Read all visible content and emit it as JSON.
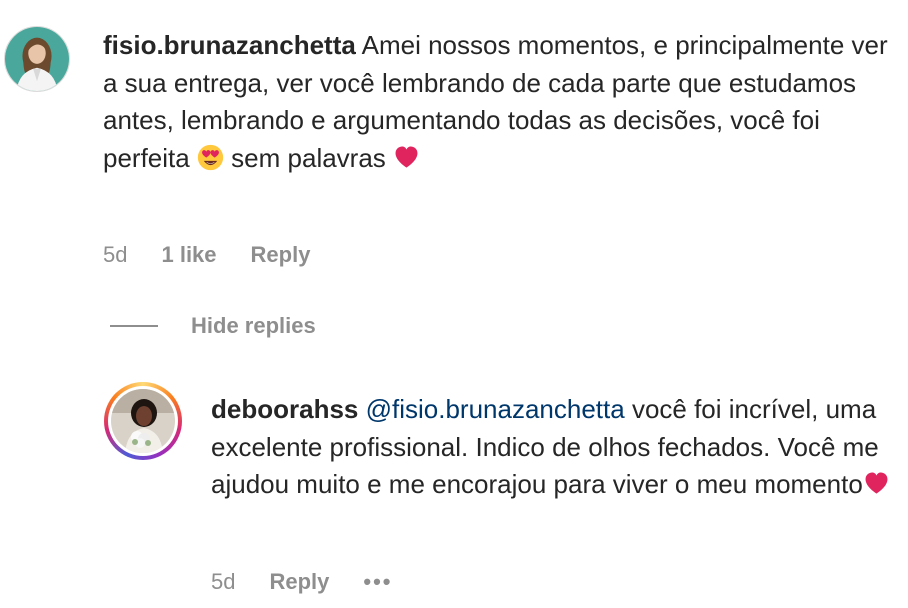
{
  "comment1": {
    "username": "fisio.brunazanchetta",
    "text_part1": " Amei nossos momentos, e principalmente ver a sua entrega, ver você lembrando de cada parte que estudamos antes, lembrando e argumentando todas as decisões, você foi perfeita ",
    "emoji1": "smiling-face-with-heart-eyes",
    "text_part2": " sem palavras ",
    "emoji2": "red-heart",
    "time": "5d",
    "likes": "1 like",
    "reply_label": "Reply",
    "avatar_icon": "avatar-fisio-brunazanchetta"
  },
  "hide_replies_label": "Hide replies",
  "comment2": {
    "username": "deboorahss",
    "mention": "@fisio.brunazanchetta",
    "text": " você foi incrível, uma excelente profissional. Indico de olhos fechados. Você me ajudou muito e me encorajou para viver o meu momento",
    "emoji": "red-heart",
    "time": "5d",
    "reply_label": "Reply",
    "more_label": "•••",
    "avatar_icon": "avatar-deboorahss"
  },
  "colors": {
    "text": "#262626",
    "secondary": "#8e8e8e",
    "mention": "#00376b",
    "heart": "#e0245e",
    "story_ring": [
      "#feda75",
      "#fa7e1e",
      "#d62976",
      "#962fbf",
      "#4f5bd5"
    ]
  }
}
